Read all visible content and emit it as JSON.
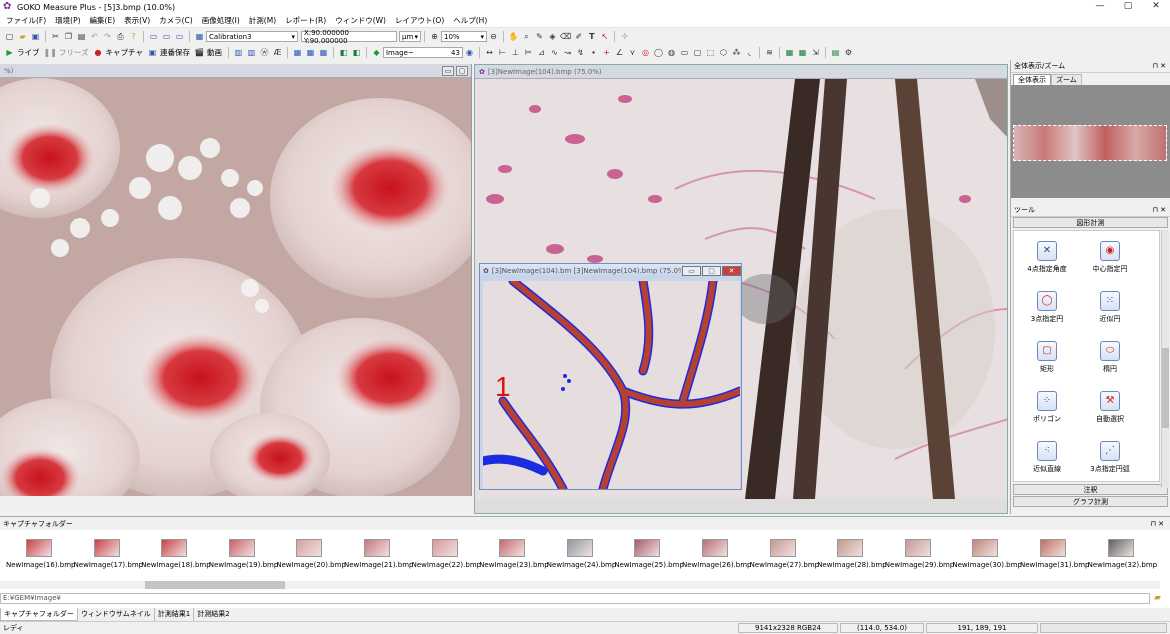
{
  "app": {
    "title": "GOKO Measure Plus - [5]3.bmp (10.0%)"
  },
  "window_controls": {
    "minimize": "—",
    "maximize": "▢",
    "close": "✕"
  },
  "menu": [
    "ファイル(F)",
    "環境(P)",
    "編集(E)",
    "表示(V)",
    "カメラ(C)",
    "画像処理(I)",
    "計測(M)",
    "レポート(R)",
    "ウィンドウ(W)",
    "レイアウト(O)",
    "ヘルプ(H)"
  ],
  "toolbar1": {
    "calibration": "Calibration3",
    "coord": "X:90.000000 Y:90.000000",
    "unit": "μm",
    "zoom": "10%"
  },
  "toolbar2": {
    "live": "ライブ",
    "freeze": "フリーズ",
    "capture": "キャプチャ",
    "quicksave": "連番保存",
    "movie": "動画",
    "image_combo": "Image~",
    "image_num": "43"
  },
  "left_pane": {
    "title": "%)"
  },
  "right_pane": {
    "title": "[3]NewImage(104).bmp (75.0%)"
  },
  "sub_window": {
    "title": "[3]NewImage(104).bm [3]NewImage(104).bmp (75.0%)",
    "label": "1"
  },
  "overview_panel": {
    "title": "全体表示/ズーム",
    "tabs": [
      "全体表示",
      "ズーム"
    ]
  },
  "tool_panel": {
    "title": "ツール",
    "section": "図形計測",
    "tools": [
      {
        "label": "4点指定角度",
        "icon": "angle-icon"
      },
      {
        "label": "中心指定円",
        "icon": "center-circle-icon"
      },
      {
        "label": "3点指定円",
        "icon": "three-point-circle-icon"
      },
      {
        "label": "近似円",
        "icon": "approx-circle-icon"
      },
      {
        "label": "矩形",
        "icon": "rectangle-icon"
      },
      {
        "label": "楕円",
        "icon": "ellipse-icon"
      },
      {
        "label": "ポリゴン",
        "icon": "polygon-icon"
      },
      {
        "label": "自動選択",
        "icon": "auto-select-icon"
      },
      {
        "label": "近似直線",
        "icon": "approx-line-icon"
      },
      {
        "label": "3点指定円弧",
        "icon": "arc-icon"
      }
    ],
    "footer": [
      "注釈",
      "グラフ計測"
    ]
  },
  "capture_folder": {
    "title": "キャプチャフォルダー",
    "path": "E:¥GEM¥Image¥",
    "thumbnails": [
      "NewImage(16).bmp",
      "NewImage(17).bmp",
      "NewImage(18).bmp",
      "NewImage(19).bmp",
      "NewImage(20).bmp",
      "NewImage(21).bmp",
      "NewImage(22).bmp",
      "NewImage(23).bmp",
      "NewImage(24).bmp",
      "NewImage(25).bmp",
      "NewImage(26).bmp",
      "NewImage(27).bmp",
      "NewImage(28).bmp",
      "NewImage(29).bmp",
      "NewImage(30).bmp",
      "NewImage(31).bmp",
      "NewImage(32).bmp"
    ],
    "thumb_colors": [
      "#c8424a",
      "#c8424a",
      "#c8424a",
      "#c8606a",
      "#d8a0a0",
      "#c87880",
      "#d89898",
      "#c86a70",
      "#8a9aa0",
      "#a85a6a",
      "#b87078",
      "#c89890",
      "#c09a8c",
      "#c89898",
      "#c08878",
      "#c07060",
      "#606060"
    ]
  },
  "bottom_tabs": [
    "キャプチャフォルダー",
    "ウィンドウサムネイル",
    "計測結果1",
    "計測結果2"
  ],
  "status": {
    "left": "レディ",
    "image_info": "9141x2328 RGB24",
    "pos": "(114.0, 534.0)",
    "rgb": "191, 189, 191"
  }
}
